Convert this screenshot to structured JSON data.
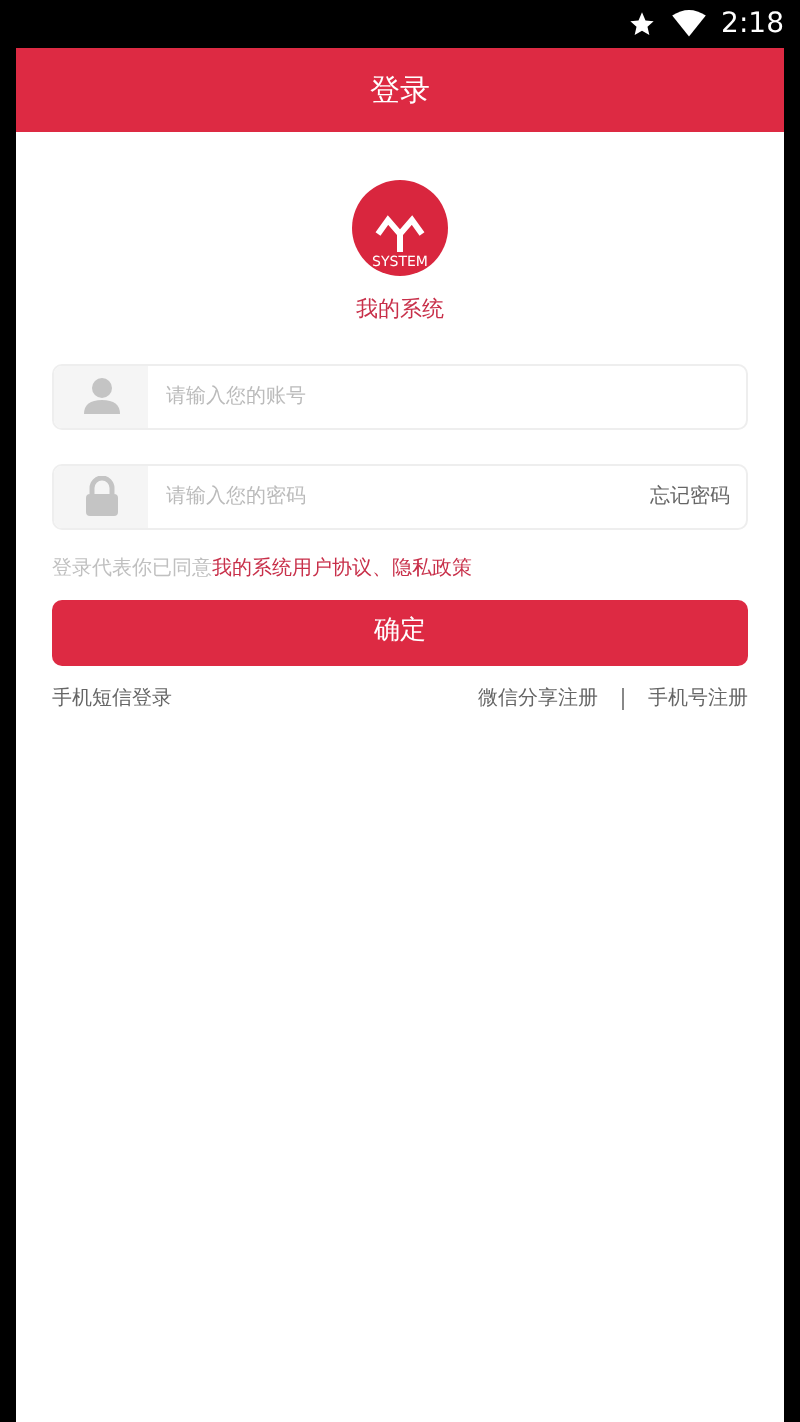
{
  "status_bar": {
    "time": "2:18"
  },
  "header": {
    "title": "登录"
  },
  "logo": {
    "text": "SYSTEM",
    "name": "我的系统"
  },
  "fields": [
    {
      "kind": "account",
      "placeholder": "请输入您的账号"
    },
    {
      "kind": "password",
      "placeholder": "请输入您的密码",
      "action": "忘记密码"
    }
  ],
  "agreement": {
    "prefix": "登录代表你已同意",
    "link": "我的系统用户协议、隐私政策"
  },
  "submit": "确定",
  "links": {
    "left": "手机短信登录",
    "right": [
      "微信分享注册",
      "手机号注册"
    ]
  }
}
